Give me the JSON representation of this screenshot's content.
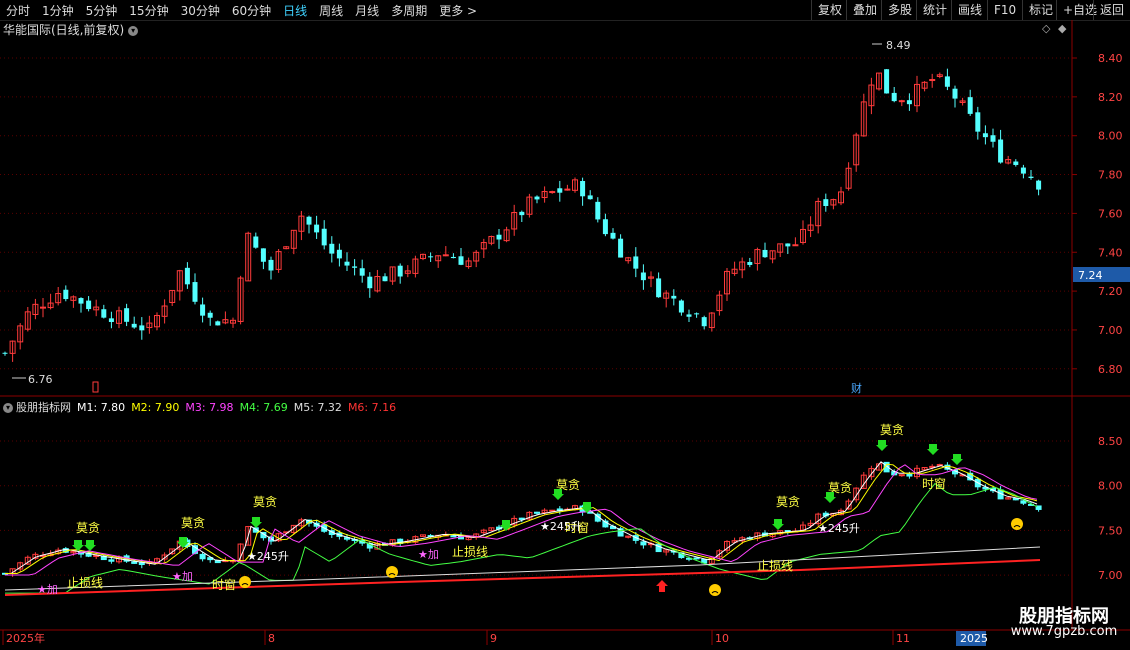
{
  "toolbar": {
    "periods": [
      "分时",
      "1分钟",
      "5分钟",
      "15分钟",
      "30分钟",
      "60分钟",
      "日线",
      "周线",
      "月线",
      "多周期",
      "更多 >"
    ],
    "active_index": 6,
    "right_buttons": [
      "复权",
      "叠加",
      "多股",
      "统计",
      "画线",
      "F10",
      "标记",
      "+自选",
      "返回"
    ]
  },
  "main_title": "华能国际(日线,前复权)",
  "price_axis": [
    "8.40",
    "8.20",
    "8.00",
    "7.80",
    "7.60",
    "7.40",
    "7.20",
    "7.00",
    "6.80"
  ],
  "current_price": "7.24",
  "high_label": "8.49",
  "low_label": "6.76",
  "marker_finance": "财",
  "indicator": {
    "name": "股朋指标网",
    "lines": [
      {
        "label": "M1: 7.80",
        "color": "#ffffff"
      },
      {
        "label": "M2: 7.90",
        "color": "#ffff00"
      },
      {
        "label": "M3: 7.98",
        "color": "#ff44ff"
      },
      {
        "label": "M4: 7.69",
        "color": "#44ff44"
      },
      {
        "label": "M5: 7.32",
        "color": "#dddddd"
      },
      {
        "label": "M6: 7.16",
        "color": "#ff3333"
      }
    ],
    "axis": [
      "8.50",
      "8.00",
      "7.50",
      "7.00"
    ],
    "annotations": {
      "greed": "莫贪",
      "stoploss": "止损线",
      "window": "时窗",
      "add": "★加",
      "rise": "★245升",
      "sell": "卖",
      "buy": "买"
    }
  },
  "time_axis": [
    "2025年",
    "8",
    "9",
    "10",
    "11",
    "2025"
  ],
  "watermark": {
    "title": "股朋指标网",
    "url": "www.7gpzb.com"
  }
}
